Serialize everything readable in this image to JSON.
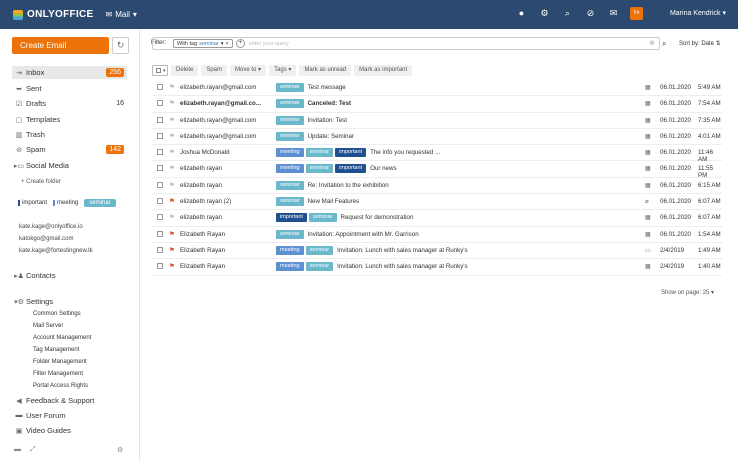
{
  "header": {
    "logo": "ONLYOFFICE",
    "module": "Mail",
    "user": "Marina Kendrick",
    "icons": [
      "help-icon",
      "gear-icon",
      "search-icon",
      "feed-icon",
      "mail-icon",
      "calendar-icon"
    ],
    "calendar_day": "Fri"
  },
  "sidebar": {
    "create_label": "Create Email",
    "folders": [
      {
        "label": "Inbox",
        "count": "256",
        "icon": "inbox-icon"
      },
      {
        "label": "Sent",
        "count": "",
        "icon": "sent-icon"
      },
      {
        "label": "Drafts",
        "count": "16",
        "icon": "drafts-icon"
      },
      {
        "label": "Templates",
        "count": "",
        "icon": "templates-icon"
      },
      {
        "label": "Trash",
        "count": "",
        "icon": "trash-icon"
      },
      {
        "label": "Spam",
        "count": "142",
        "icon": "spam-icon"
      },
      {
        "label": "Social Media",
        "count": "",
        "icon": "folder-icon"
      }
    ],
    "create_folder": "Create folder",
    "tags": [
      "important",
      "meeting",
      "seminar"
    ],
    "accounts": [
      "kate.kage@onlyoffice.io",
      "katokgo@gmail.com",
      "kate.kage@fortestingnew.tk"
    ],
    "contacts": "Contacts",
    "settings": "Settings",
    "settings_items": [
      "Common Settings",
      "Mail Server",
      "Account Management",
      "Tag Management",
      "Folder Management",
      "Filter Management",
      "Portal Access Rights"
    ],
    "feedback": "Feedback & Support",
    "forum": "User Forum",
    "videos": "Video Guides"
  },
  "filter": {
    "label": "Filter:",
    "chip_prefix": "With tag",
    "chip_value": "seminar",
    "placeholder": "enter your query",
    "sort": "Sort by: Date"
  },
  "toolbar": {
    "delete": "Delete",
    "spam": "Spam",
    "move": "Move to",
    "tags": "Tags",
    "unread": "Mark as unread",
    "important": "Mark as important"
  },
  "messages": [
    {
      "from": "elizabeth.rayan@gmail.com",
      "tags": [
        "seminar"
      ],
      "subject": "Test message",
      "date": "06.01.2020",
      "time": "5:49 AM",
      "bold": false,
      "flag": false,
      "attach": "calendar"
    },
    {
      "from": "elizabeth.rayan@gmail.co...",
      "tags": [
        "seminar"
      ],
      "subject": "Canceled: Test",
      "date": "06.01.2020",
      "time": "7:54 AM",
      "bold": true,
      "flag": false,
      "attach": "calendar"
    },
    {
      "from": "elizabeth.rayan@gmail.com",
      "tags": [
        "seminar"
      ],
      "subject": "Invitation: Test",
      "date": "06.01.2020",
      "time": "7:35 AM",
      "bold": false,
      "flag": false,
      "attach": "calendar"
    },
    {
      "from": "elizabeth.rayan@gmail.com",
      "tags": [
        "seminar"
      ],
      "subject": "Update: Seminar",
      "date": "06.01.2020",
      "time": "4:01 AM",
      "bold": false,
      "flag": false,
      "attach": "calendar"
    },
    {
      "from": "Joshua McDonald",
      "tags": [
        "meeting",
        "seminar",
        "important"
      ],
      "subject": "The info you requested ...",
      "date": "06.01.2020",
      "time": "11:46 AM",
      "bold": false,
      "flag": false,
      "attach": "calendar"
    },
    {
      "from": "elizabeth rayan",
      "tags": [
        "meeting",
        "seminar",
        "important"
      ],
      "subject": "Our news",
      "date": "06.01.2020",
      "time": "11:55 PM",
      "bold": false,
      "flag": false,
      "attach": "calendar"
    },
    {
      "from": "elizabeth rayan",
      "tags": [
        "seminar"
      ],
      "subject": "Re: Invitation to the exhibition",
      "date": "06.01.2020",
      "time": "6:15 AM",
      "bold": false,
      "flag": false,
      "attach": "calendar"
    },
    {
      "from": "elizabeth rayan (2)",
      "tags": [
        "seminar"
      ],
      "subject": "New Mail Features",
      "date": "06.01.2020",
      "time": "6:07 AM",
      "bold": false,
      "flag": true,
      "attach": "clip"
    },
    {
      "from": "elizabeth rayan",
      "tags": [
        "important",
        "seminar"
      ],
      "subject": "Request for demonstration",
      "date": "06.01.2020",
      "time": "6:07 AM",
      "bold": false,
      "flag": false,
      "attach": "calendar"
    },
    {
      "from": "Elizabeth Rayan",
      "tags": [
        "seminar"
      ],
      "subject": "Invitation: Appointment with Mr. Garrison",
      "date": "06.01.2020",
      "time": "1:54 AM",
      "bold": false,
      "flag": true,
      "attach": "calendar"
    },
    {
      "from": "Elizabeth Rayan",
      "tags": [
        "meeting",
        "seminar"
      ],
      "subject": "Invitation: Lunch with sales manager at Runky's",
      "date": "2/4/2019",
      "time": "1:49 AM",
      "bold": false,
      "flag": true,
      "attach": "calendar-outline"
    },
    {
      "from": "Elizabeth Rayan",
      "tags": [
        "meeting",
        "seminar"
      ],
      "subject": "Invitation: Lunch with sales manager at Runky's",
      "date": "2/4/2019",
      "time": "1:40 AM",
      "bold": false,
      "flag": true,
      "attach": "calendar"
    }
  ],
  "pager": {
    "label": "Show on page:",
    "value": "25"
  }
}
